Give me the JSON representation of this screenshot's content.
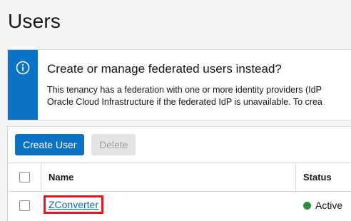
{
  "page": {
    "title": "Users"
  },
  "notice": {
    "icon": "info-icon",
    "title": "Create or manage federated users instead?",
    "line1": "This tenancy has a federation with one or more identity providers (IdP",
    "line2": "Oracle Cloud Infrastructure if the federated IdP is unavailable. To crea",
    "accent": "#0b72c4"
  },
  "toolbar": {
    "create_label": "Create User",
    "delete_label": "Delete"
  },
  "table": {
    "headers": {
      "name": "Name",
      "status": "Status"
    },
    "rows": [
      {
        "name": "ZConverter",
        "status": "Active",
        "status_color": "#2a8d3a"
      }
    ]
  }
}
